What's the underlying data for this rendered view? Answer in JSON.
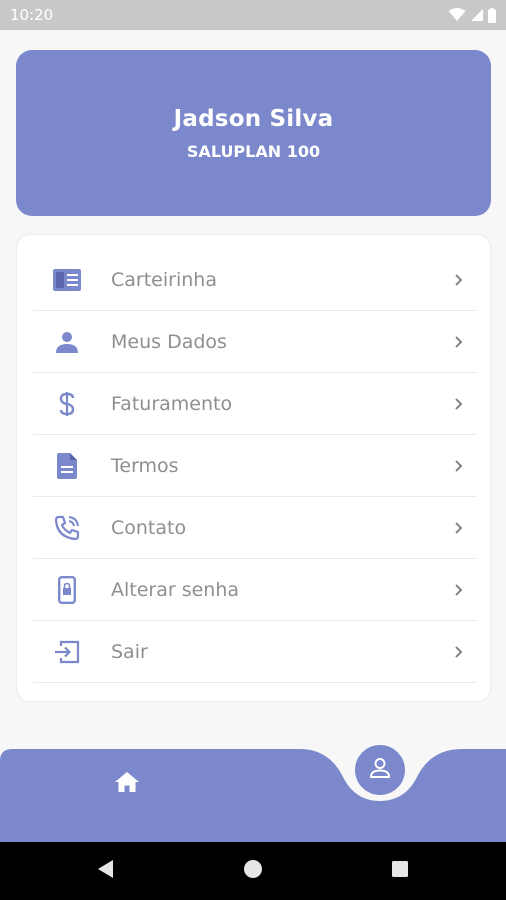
{
  "status_bar": {
    "time": "10:20"
  },
  "profile": {
    "name": "Jadson Silva",
    "plan": "SALUPLAN 100"
  },
  "menu": {
    "items": [
      {
        "label": "Carteirinha",
        "icon": "card-icon"
      },
      {
        "label": "Meus Dados",
        "icon": "person-icon"
      },
      {
        "label": "Faturamento",
        "icon": "dollar-icon"
      },
      {
        "label": "Termos",
        "icon": "document-icon"
      },
      {
        "label": "Contato",
        "icon": "phone-icon"
      },
      {
        "label": "Alterar senha",
        "icon": "phone-lock-icon"
      },
      {
        "label": "Sair",
        "icon": "exit-icon"
      }
    ]
  },
  "colors": {
    "accent": "#7b88cc",
    "text_muted": "#8f8f8f",
    "background": "#f7f7f7"
  }
}
